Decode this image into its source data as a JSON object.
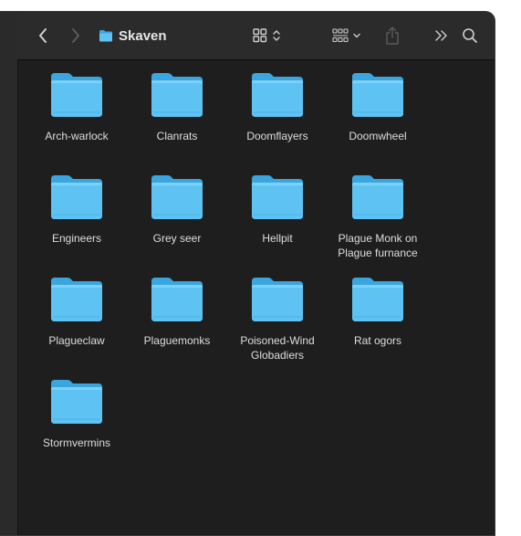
{
  "window": {
    "title": "Skaven",
    "folder_icon": "folder-icon"
  },
  "toolbar": {
    "back_icon": "chevron-left-icon",
    "forward_icon": "chevron-right-icon",
    "view_icon": "icon-grid-view-icon",
    "group_icon": "group-by-icon",
    "share_icon": "share-icon",
    "more_icon": "double-chevron-right-icon",
    "search_icon": "search-icon"
  },
  "colors": {
    "folder_blue": "#5ec3f2",
    "folder_tab": "#3aa6e0",
    "background": "#1e1e1e",
    "toolbar": "#2b2b2b",
    "label": "#dedede"
  },
  "items": [
    {
      "label": "Arch-warlock"
    },
    {
      "label": "Clanrats"
    },
    {
      "label": "Doomflayers"
    },
    {
      "label": "Doomwheel"
    },
    {
      "label": "Engineers"
    },
    {
      "label": "Grey seer"
    },
    {
      "label": "Hellpit"
    },
    {
      "label": "Plague Monk on Plague furnance"
    },
    {
      "label": "Plagueclaw"
    },
    {
      "label": "Plaguemonks"
    },
    {
      "label": "Poisoned-Wind Globadiers"
    },
    {
      "label": "Rat ogors"
    },
    {
      "label": "Stormvermins"
    }
  ]
}
